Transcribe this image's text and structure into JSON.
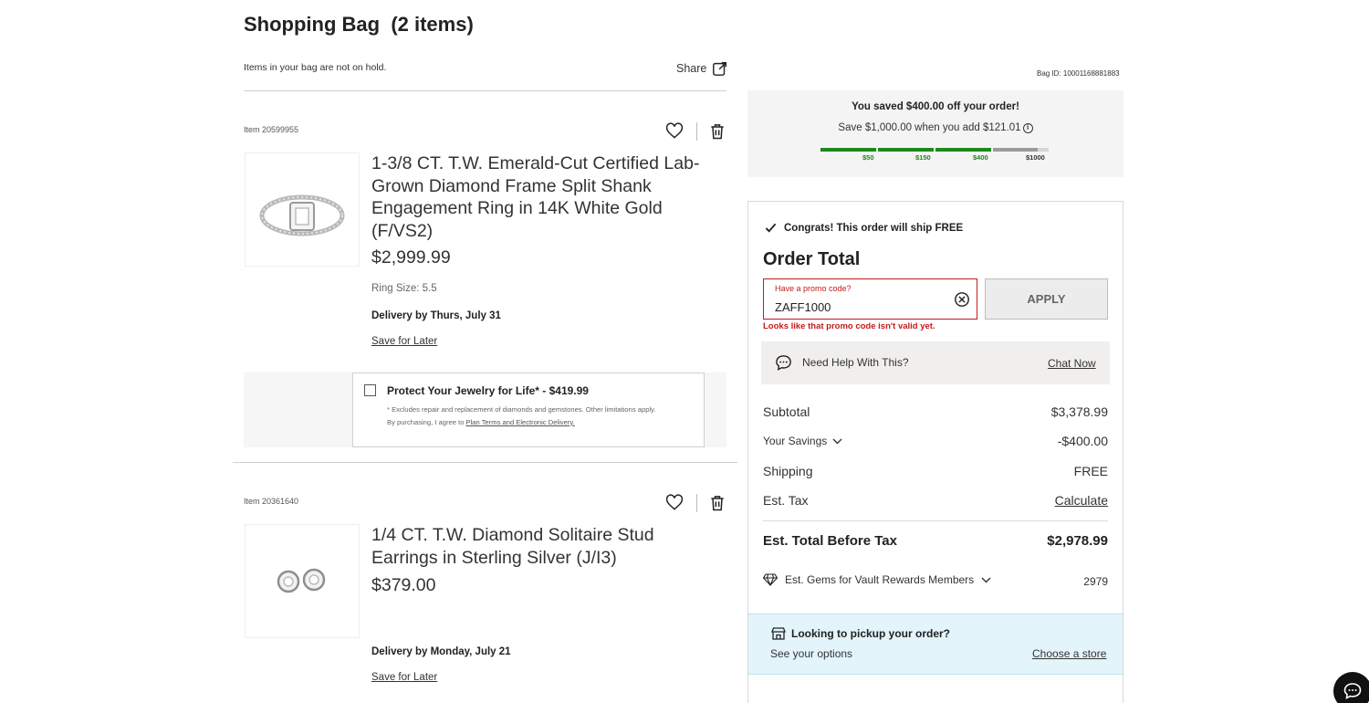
{
  "header": {
    "title": "Shopping Bag  (2 items)",
    "hold_note": "Items in your bag are not on hold.",
    "share_label": "Share",
    "bag_id": "Bag ID: 10001168881883"
  },
  "items": [
    {
      "item_number": "Item 20599955",
      "title": "1-3/8 CT. T.W. Emerald-Cut Certified Lab-Grown Diamond Frame Split Shank Engagement Ring in 14K White Gold (F/VS2)",
      "price": "$2,999.99",
      "ring_size": "Ring Size: 5.5",
      "delivery": "Delivery by Thurs, July 31",
      "save_for_later": "Save for Later",
      "protection": {
        "title": "Protect Your Jewelry for Life* - $419.99",
        "fine_print_1": "* Excludes repair and replacement of diamonds and gemstones. Other limitations apply.",
        "fine_print_2": "By purchasing, I agree to ",
        "terms_link": "Plan Terms and Electronic Delivery.",
        "checked": false
      }
    },
    {
      "item_number": "Item 20361640",
      "title": "1/4 CT. T.W. Diamond Solitaire Stud Earrings in Sterling Silver (J/I3)",
      "price": "$379.00",
      "delivery": "Delivery by Monday, July 21",
      "save_for_later": "Save for Later"
    }
  ],
  "savings_banner": {
    "saved": "You saved $400.00 off your order!",
    "save_more": "Save $1,000.00 when you add $121.01",
    "tiers": [
      {
        "label": "$50",
        "reached": true
      },
      {
        "label": "$150",
        "reached": true
      },
      {
        "label": "$400",
        "reached": true
      },
      {
        "label": "$1000",
        "reached": false
      }
    ],
    "colors": {
      "reached": "#1a8a1a",
      "unreached": "#9a9a9a",
      "track": "#d6d6d6"
    }
  },
  "order": {
    "ship_free": "Congrats! This order will ship FREE",
    "title": "Order Total",
    "promo_label": "Have a promo code?",
    "promo_value": "ZAFF1000",
    "apply_label": "APPLY",
    "promo_error": "Looks like that promo code isn't valid yet.",
    "help_text": "Need Help With This?",
    "chat_now": "Chat Now",
    "subtotal_label": "Subtotal",
    "subtotal_value": "$3,378.99",
    "savings_label": "Your Savings",
    "savings_value": "-$400.00",
    "shipping_label": "Shipping",
    "shipping_value": "FREE",
    "tax_label": "Est. Tax",
    "tax_value": "Calculate",
    "total_label": "Est. Total Before Tax",
    "total_value": "$2,978.99",
    "gems_label": "Est. Gems for Vault Rewards Members",
    "gems_value": "2979"
  },
  "pickup": {
    "title": "Looking to pickup your order?",
    "subtitle": "See your options",
    "link": "Choose a store"
  },
  "colors": {
    "error": "#c41a1a",
    "pickup_bg": "#e3f4fb",
    "help_bg": "#f0efed"
  }
}
